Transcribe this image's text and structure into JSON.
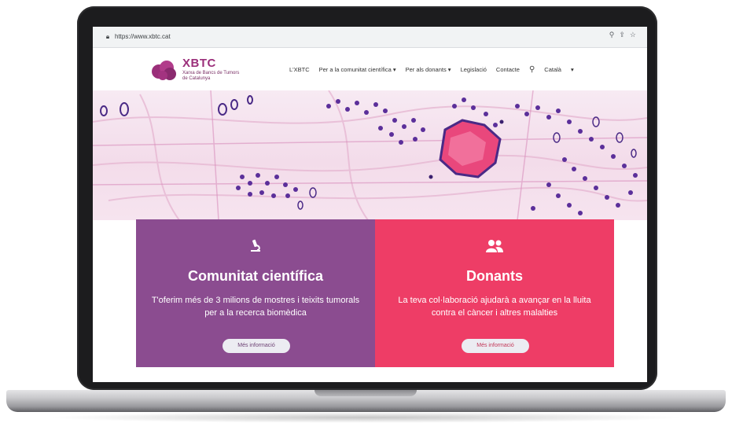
{
  "browser": {
    "url": "https://www.xbtc.cat",
    "icons": [
      "zoom-icon",
      "share-icon",
      "star-icon"
    ]
  },
  "site": {
    "logo": {
      "title": "XBTC",
      "subtitle": "Xarxa de Bancs de Tumors de Catalunya",
      "color": "#9b2f7a"
    },
    "nav": {
      "items": [
        "L'XBTC",
        "Per a la comunitat científica ▾",
        "Per als donants ▾",
        "Legislació",
        "Contacte"
      ],
      "language": "Català",
      "language_caret": "▾"
    }
  },
  "cards": [
    {
      "icon": "microscope-icon",
      "title": "Comunitat científica",
      "text": "T'oferim més de 3 milions de mostres i teixits tumorals per a la recerca biomèdica",
      "button": "Més informació",
      "color": "#8b4c90"
    },
    {
      "icon": "people-icon",
      "title": "Donants",
      "text": "La teva col·laboració ajudarà a avançar en la lluita contra el càncer i altres malalties",
      "button": "Més informació",
      "color": "#ee3d66"
    }
  ]
}
